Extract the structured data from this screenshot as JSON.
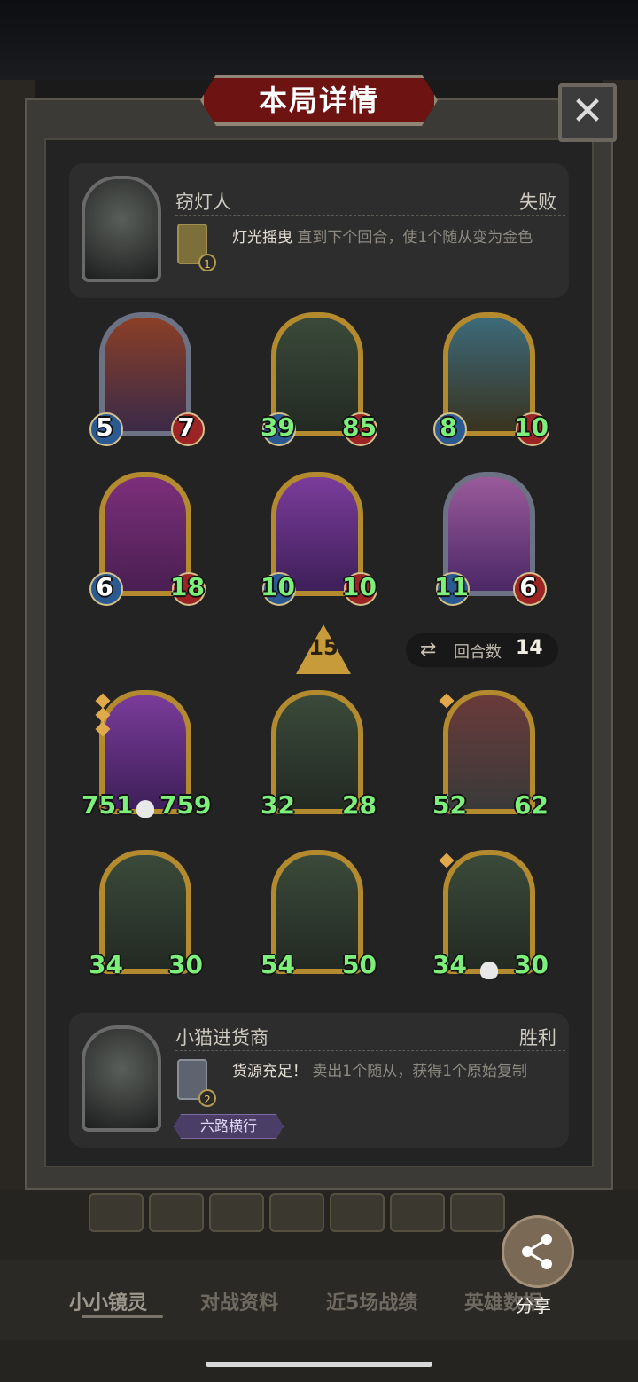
{
  "title": "本局详情",
  "close_label": "✕",
  "opponent": {
    "name": "窃灯人",
    "result": "失败",
    "skill_name": "灯光摇曳",
    "skill_desc": "直到下个回合，使1个随从变为金色",
    "skill_badge": "1"
  },
  "player": {
    "name": "小猫进货商",
    "result": "胜利",
    "skill_name": "货源充足！",
    "skill_desc": "卖出1个随从，获得1个原始复制",
    "skill_badge": "2",
    "tag": "六路横行"
  },
  "tier": "15",
  "rounds": {
    "label": "回合数",
    "value": "14"
  },
  "opponent_minions": [
    {
      "atk": "5",
      "hp": "7"
    },
    {
      "atk": "39",
      "hp": "85"
    },
    {
      "atk": "8",
      "hp": "10"
    },
    {
      "atk": "6",
      "hp": "18"
    },
    {
      "atk": "10",
      "hp": "10"
    },
    {
      "atk": "11",
      "hp": "6"
    }
  ],
  "player_minions": [
    {
      "atk": "751",
      "hp": "759"
    },
    {
      "atk": "32",
      "hp": "28"
    },
    {
      "atk": "52",
      "hp": "62"
    },
    {
      "atk": "34",
      "hp": "30"
    },
    {
      "atk": "54",
      "hp": "50"
    },
    {
      "atk": "34",
      "hp": "30"
    }
  ],
  "tabs": [
    "小小镜灵",
    "对战资料",
    "近5场战绩",
    "英雄数据"
  ],
  "share_label": "分享"
}
